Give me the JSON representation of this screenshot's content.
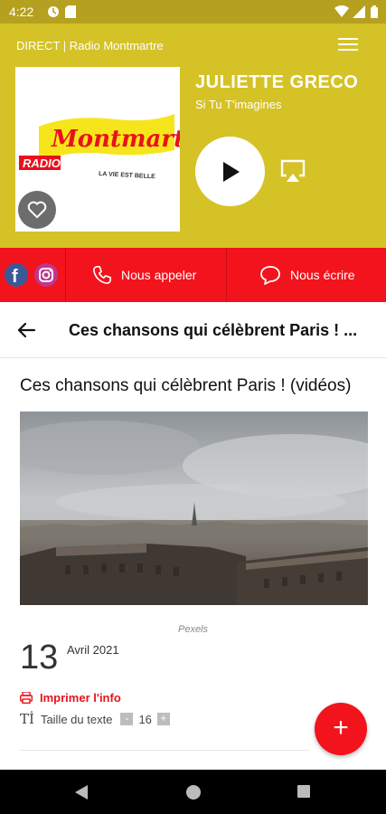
{
  "status_bar": {
    "time": "4:22",
    "icons": [
      "notification-icon",
      "sd-card-icon",
      "wifi-icon",
      "signal-icon",
      "battery-icon"
    ]
  },
  "header": {
    "station_label": "DIRECT | Radio Montmartre",
    "menu_icon": "hamburger-menu-icon"
  },
  "player": {
    "logo_text": {
      "brand": "Montmartre",
      "tag": "RADIO",
      "slogan": "LA VIE EST BELLE"
    },
    "artist": "JULIETTE GRECO",
    "song": "Si Tu T'imagines",
    "play_icon": "play-icon",
    "cast_icon": "airplay-icon",
    "favorite_icon": "heart-icon"
  },
  "contact_bar": {
    "social": [
      "facebook-icon",
      "instagram-icon"
    ],
    "call_label": "Nous appeler",
    "write_label": "Nous écrire"
  },
  "article": {
    "header_title": "Ces chansons qui célèbrent Paris ! ...",
    "title": "Ces chansons qui célèbrent Paris ! (vidéos)",
    "image_caption": "Pexels",
    "day": "13",
    "month_year": "Avril 2021",
    "print_label": "Imprimer l'info",
    "text_size_label": "Taille du texte",
    "text_size_value": "16",
    "decrease_label": "-",
    "increase_label": "+"
  },
  "fab_label": "+",
  "colors": {
    "player_bg": "#d4c227",
    "status_bg": "#b5a020",
    "accent_red": "#f3131c"
  }
}
